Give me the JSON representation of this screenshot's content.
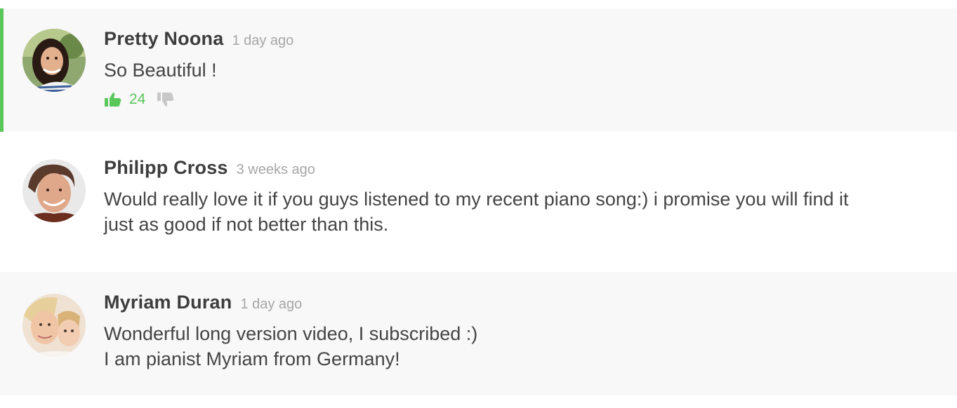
{
  "comments": [
    {
      "author": "Pretty Noona",
      "time": "1 day ago",
      "lines": [
        "So Beautiful !"
      ],
      "likes": "24",
      "highlighted": true,
      "accent_color": "#5ac75a",
      "avatar": "avatar-young-woman"
    },
    {
      "author": "Philipp Cross",
      "time": "3 weeks ago",
      "lines": [
        "Would really love it if you guys listened to my recent piano song:) i promise you will find it",
        "just as good if not better than this."
      ],
      "avatar": "avatar-smiling-man"
    },
    {
      "author": "Myriam Duran",
      "time": "1 day ago",
      "lines": [
        "Wonderful long version video, I subscribed :)",
        "I am pianist Myriam from Germany!"
      ],
      "avatar": "avatar-woman-and-child"
    }
  ],
  "icons": {
    "like": "thumbs-up-icon",
    "dislike": "thumbs-down-icon"
  }
}
